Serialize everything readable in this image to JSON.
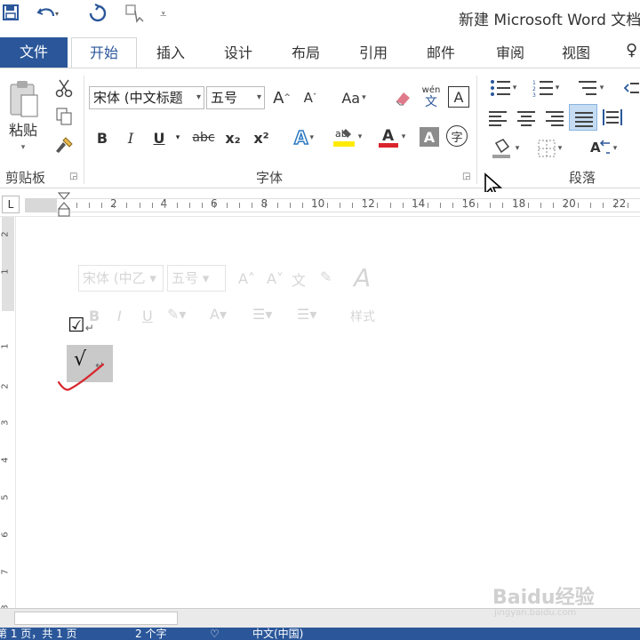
{
  "window": {
    "title": "新建 Microsoft Word 文档"
  },
  "quick_access": {
    "save_icon": "save-icon",
    "undo_icon": "undo-icon",
    "redo_icon": "redo-icon",
    "touch_icon": "touch-mode-icon",
    "customize_icon": "customize-icon"
  },
  "tabs": [
    {
      "label": "文件"
    },
    {
      "label": "开始"
    },
    {
      "label": "插入"
    },
    {
      "label": "设计"
    },
    {
      "label": "布局"
    },
    {
      "label": "引用"
    },
    {
      "label": "邮件"
    },
    {
      "label": "审阅"
    },
    {
      "label": "视图"
    }
  ],
  "ribbon": {
    "clipboard": {
      "paste_label": "粘贴",
      "group_label": "剪贴板"
    },
    "font": {
      "font_name": "宋体 (中文标题",
      "font_size": "五号",
      "bold": "B",
      "italic": "I",
      "underline": "U",
      "strike": "abc",
      "subscript": "x₂",
      "superscript": "x²",
      "change_case": "Aa",
      "phonetic_top": "wén",
      "phonetic_bottom": "文",
      "char_border": "A",
      "char_shading": "A",
      "enclose": "字",
      "grow": "A",
      "shrink": "A",
      "group_label": "字体"
    },
    "paragraph": {
      "group_label": "段落"
    }
  },
  "ruler": {
    "tab_selector": "L",
    "numbers": [
      "2",
      "4",
      "6",
      "8",
      "10",
      "12",
      "14",
      "16",
      "18",
      "20",
      "22"
    ],
    "vertical_numbers": [
      "2",
      "1",
      "1",
      "2",
      "3",
      "4",
      "5",
      "6",
      "7",
      "8"
    ]
  },
  "mini_toolbar": {
    "font_name": "宋体 (中乙",
    "font_size": "五号",
    "styles_label": "样式"
  },
  "document": {
    "checkbox_char": "☑",
    "check_char": "√",
    "paragraph_mark": "↵"
  },
  "statusbar": {
    "page": "第 1 页，共 1 页",
    "words": "2 个字",
    "language": "中文(中国)"
  },
  "watermark": {
    "brand": "Baidu经验",
    "url": "jingyan.baidu.com"
  },
  "colors": {
    "accent": "#2b579a",
    "selection": "#c9c9c9",
    "annotation": "#d9242b"
  }
}
